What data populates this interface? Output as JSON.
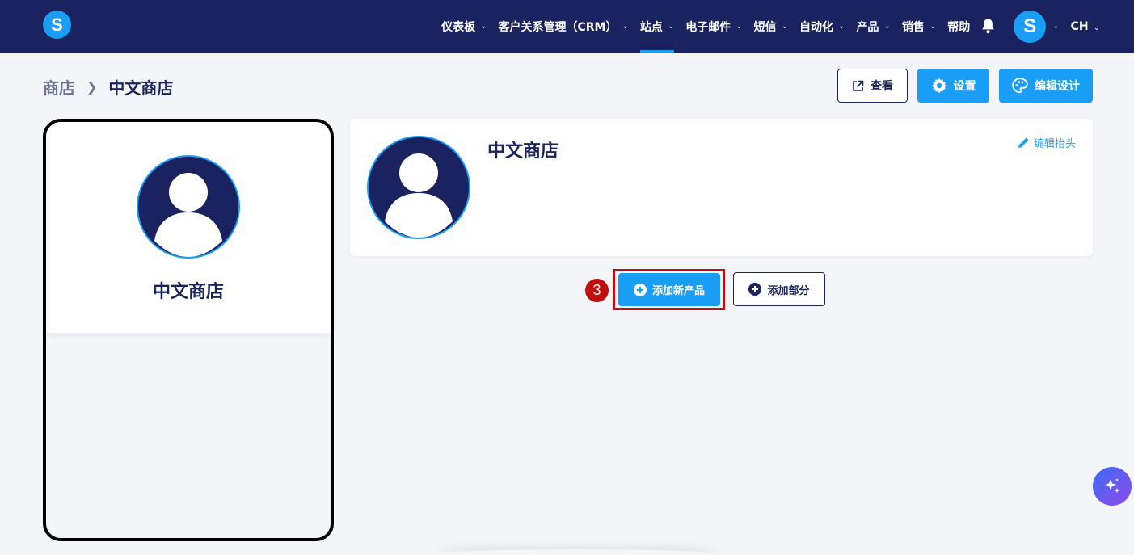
{
  "app": {
    "logo_letter": "S"
  },
  "nav": {
    "items": [
      {
        "label": "仪表板",
        "has_dropdown": true
      },
      {
        "label": "客户关系管理（CRM）",
        "has_dropdown": true
      },
      {
        "label": "站点",
        "has_dropdown": true,
        "active": true
      },
      {
        "label": "电子邮件",
        "has_dropdown": true
      },
      {
        "label": "短信",
        "has_dropdown": true
      },
      {
        "label": "自动化",
        "has_dropdown": true
      },
      {
        "label": "产品",
        "has_dropdown": true
      },
      {
        "label": "销售",
        "has_dropdown": true
      },
      {
        "label": "帮助",
        "has_dropdown": false
      }
    ],
    "notification_icon": "bell-icon",
    "user_avatar_letter": "S",
    "language": "CH"
  },
  "breadcrumb": {
    "root": "商店",
    "current": "中文商店"
  },
  "toolbar": {
    "view_label": "查看",
    "settings_label": "设置",
    "edit_design_label": "编辑设计"
  },
  "preview": {
    "store_name": "中文商店"
  },
  "header_card": {
    "title": "中文商店",
    "edit_header_label": "编辑抬头"
  },
  "content_actions": {
    "step_number": "3",
    "add_product_label": "添加新产品",
    "add_section_label": "添加部分"
  },
  "colors": {
    "nav_bg": "#1a2360",
    "accent": "#1a9df4",
    "highlight": "#c00d10",
    "text_dark": "#1b2559"
  }
}
